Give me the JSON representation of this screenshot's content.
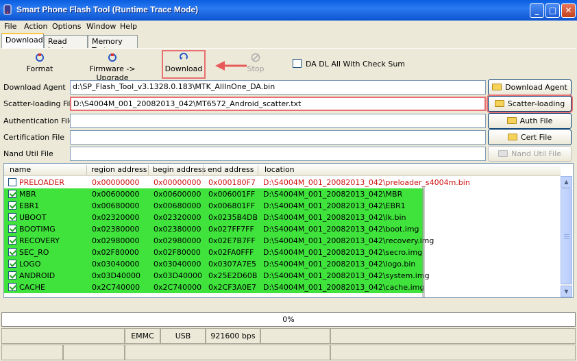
{
  "window": {
    "title": "Smart Phone Flash Tool (Runtime Trace Mode)",
    "buttons": [
      "_",
      "□",
      "✕"
    ]
  },
  "menu": [
    "File",
    "Action",
    "Options",
    "Window",
    "Help"
  ],
  "tabs": [
    {
      "label": "Download",
      "active": true
    },
    {
      "label": "Read back",
      "active": false
    },
    {
      "label": "Memory Test",
      "active": false
    }
  ],
  "toolbar": {
    "format_label": "Format",
    "firmware_label": "Firmware -> Upgrade",
    "download_label": "Download",
    "stop_label": "Stop",
    "da_checksum_label": "DA DL All With Check Sum"
  },
  "fields": [
    {
      "label": "Download Agent",
      "value": "d:\\SP_Flash_Tool_v3.1328.0.183\\MTK_AllInOne_DA.bin",
      "button": "Download Agent",
      "button_enabled": true
    },
    {
      "label": "Scatter-loading File",
      "value": "D:\\S4004M_001_20082013_042\\MT6572_Android_scatter.txt",
      "button": "Scatter-loading",
      "button_enabled": true
    },
    {
      "label": "Authentication File",
      "value": "",
      "button": "Auth File",
      "button_enabled": true
    },
    {
      "label": "Certification File",
      "value": "",
      "button": "Cert File",
      "button_enabled": true
    },
    {
      "label": "Nand Util File",
      "value": "",
      "button": "Nand Util File",
      "button_enabled": false
    }
  ],
  "table": {
    "columns": [
      "name",
      "region address",
      "begin address",
      "end address",
      "location"
    ],
    "rows": [
      {
        "checked": false,
        "name": "PRELOADER",
        "region": "0x00000000",
        "begin": "0x00000000",
        "end": "0x000180F7",
        "location": "D:\\S4004M_001_20082013_042\\preloader_s4004m.bin"
      },
      {
        "checked": true,
        "name": "MBR",
        "region": "0x00600000",
        "begin": "0x00600000",
        "end": "0x006001FF",
        "location": "D:\\S4004M_001_20082013_042\\MBR"
      },
      {
        "checked": true,
        "name": "EBR1",
        "region": "0x00680000",
        "begin": "0x00680000",
        "end": "0x006801FF",
        "location": "D:\\S4004M_001_20082013_042\\EBR1"
      },
      {
        "checked": true,
        "name": "UBOOT",
        "region": "0x02320000",
        "begin": "0x02320000",
        "end": "0x0235B4DB",
        "location": "D:\\S4004M_001_20082013_042\\lk.bin"
      },
      {
        "checked": true,
        "name": "BOOTIMG",
        "region": "0x02380000",
        "begin": "0x02380000",
        "end": "0x027FF7FF",
        "location": "D:\\S4004M_001_20082013_042\\boot.img"
      },
      {
        "checked": true,
        "name": "RECOVERY",
        "region": "0x02980000",
        "begin": "0x02980000",
        "end": "0x02E7B7FF",
        "location": "D:\\S4004M_001_20082013_042\\recovery.img"
      },
      {
        "checked": true,
        "name": "SEC_RO",
        "region": "0x02F80000",
        "begin": "0x02F80000",
        "end": "0x02FA0FFF",
        "location": "D:\\S4004M_001_20082013_042\\secro.img"
      },
      {
        "checked": true,
        "name": "LOGO",
        "region": "0x03040000",
        "begin": "0x03040000",
        "end": "0x0307A7E5",
        "location": "D:\\S4004M_001_20082013_042\\logo.bin"
      },
      {
        "checked": true,
        "name": "ANDROID",
        "region": "0x03D40000",
        "begin": "0x03D40000",
        "end": "0x25E2D60B",
        "location": "D:\\S4004M_001_20082013_042\\system.img"
      },
      {
        "checked": true,
        "name": "CACHE",
        "region": "0x2C740000",
        "begin": "0x2C740000",
        "end": "0x2CF3A0E7",
        "location": "D:\\S4004M_001_20082013_042\\cache.img"
      }
    ]
  },
  "progress": {
    "text": "0%",
    "value": 0
  },
  "statusbar": {
    "storage": "EMMC",
    "port": "USB",
    "baud": "921600 bps"
  },
  "colors": {
    "enabled_row": "#3fe33c",
    "disabled_row_text": "#d01010",
    "highlight": "#e87070"
  }
}
